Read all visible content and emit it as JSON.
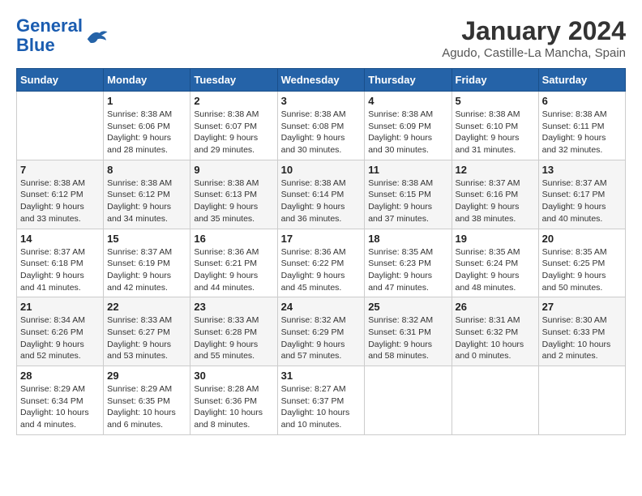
{
  "logo": {
    "line1": "General",
    "line2": "Blue"
  },
  "title": "January 2024",
  "subtitle": "Agudo, Castille-La Mancha, Spain",
  "headers": [
    "Sunday",
    "Monday",
    "Tuesday",
    "Wednesday",
    "Thursday",
    "Friday",
    "Saturday"
  ],
  "weeks": [
    [
      {
        "day": "",
        "info": ""
      },
      {
        "day": "1",
        "info": "Sunrise: 8:38 AM\nSunset: 6:06 PM\nDaylight: 9 hours\nand 28 minutes."
      },
      {
        "day": "2",
        "info": "Sunrise: 8:38 AM\nSunset: 6:07 PM\nDaylight: 9 hours\nand 29 minutes."
      },
      {
        "day": "3",
        "info": "Sunrise: 8:38 AM\nSunset: 6:08 PM\nDaylight: 9 hours\nand 30 minutes."
      },
      {
        "day": "4",
        "info": "Sunrise: 8:38 AM\nSunset: 6:09 PM\nDaylight: 9 hours\nand 30 minutes."
      },
      {
        "day": "5",
        "info": "Sunrise: 8:38 AM\nSunset: 6:10 PM\nDaylight: 9 hours\nand 31 minutes."
      },
      {
        "day": "6",
        "info": "Sunrise: 8:38 AM\nSunset: 6:11 PM\nDaylight: 9 hours\nand 32 minutes."
      }
    ],
    [
      {
        "day": "7",
        "info": "Sunrise: 8:38 AM\nSunset: 6:12 PM\nDaylight: 9 hours\nand 33 minutes."
      },
      {
        "day": "8",
        "info": "Sunrise: 8:38 AM\nSunset: 6:12 PM\nDaylight: 9 hours\nand 34 minutes."
      },
      {
        "day": "9",
        "info": "Sunrise: 8:38 AM\nSunset: 6:13 PM\nDaylight: 9 hours\nand 35 minutes."
      },
      {
        "day": "10",
        "info": "Sunrise: 8:38 AM\nSunset: 6:14 PM\nDaylight: 9 hours\nand 36 minutes."
      },
      {
        "day": "11",
        "info": "Sunrise: 8:38 AM\nSunset: 6:15 PM\nDaylight: 9 hours\nand 37 minutes."
      },
      {
        "day": "12",
        "info": "Sunrise: 8:37 AM\nSunset: 6:16 PM\nDaylight: 9 hours\nand 38 minutes."
      },
      {
        "day": "13",
        "info": "Sunrise: 8:37 AM\nSunset: 6:17 PM\nDaylight: 9 hours\nand 40 minutes."
      }
    ],
    [
      {
        "day": "14",
        "info": "Sunrise: 8:37 AM\nSunset: 6:18 PM\nDaylight: 9 hours\nand 41 minutes."
      },
      {
        "day": "15",
        "info": "Sunrise: 8:37 AM\nSunset: 6:19 PM\nDaylight: 9 hours\nand 42 minutes."
      },
      {
        "day": "16",
        "info": "Sunrise: 8:36 AM\nSunset: 6:21 PM\nDaylight: 9 hours\nand 44 minutes."
      },
      {
        "day": "17",
        "info": "Sunrise: 8:36 AM\nSunset: 6:22 PM\nDaylight: 9 hours\nand 45 minutes."
      },
      {
        "day": "18",
        "info": "Sunrise: 8:35 AM\nSunset: 6:23 PM\nDaylight: 9 hours\nand 47 minutes."
      },
      {
        "day": "19",
        "info": "Sunrise: 8:35 AM\nSunset: 6:24 PM\nDaylight: 9 hours\nand 48 minutes."
      },
      {
        "day": "20",
        "info": "Sunrise: 8:35 AM\nSunset: 6:25 PM\nDaylight: 9 hours\nand 50 minutes."
      }
    ],
    [
      {
        "day": "21",
        "info": "Sunrise: 8:34 AM\nSunset: 6:26 PM\nDaylight: 9 hours\nand 52 minutes."
      },
      {
        "day": "22",
        "info": "Sunrise: 8:33 AM\nSunset: 6:27 PM\nDaylight: 9 hours\nand 53 minutes."
      },
      {
        "day": "23",
        "info": "Sunrise: 8:33 AM\nSunset: 6:28 PM\nDaylight: 9 hours\nand 55 minutes."
      },
      {
        "day": "24",
        "info": "Sunrise: 8:32 AM\nSunset: 6:29 PM\nDaylight: 9 hours\nand 57 minutes."
      },
      {
        "day": "25",
        "info": "Sunrise: 8:32 AM\nSunset: 6:31 PM\nDaylight: 9 hours\nand 58 minutes."
      },
      {
        "day": "26",
        "info": "Sunrise: 8:31 AM\nSunset: 6:32 PM\nDaylight: 10 hours\nand 0 minutes."
      },
      {
        "day": "27",
        "info": "Sunrise: 8:30 AM\nSunset: 6:33 PM\nDaylight: 10 hours\nand 2 minutes."
      }
    ],
    [
      {
        "day": "28",
        "info": "Sunrise: 8:29 AM\nSunset: 6:34 PM\nDaylight: 10 hours\nand 4 minutes."
      },
      {
        "day": "29",
        "info": "Sunrise: 8:29 AM\nSunset: 6:35 PM\nDaylight: 10 hours\nand 6 minutes."
      },
      {
        "day": "30",
        "info": "Sunrise: 8:28 AM\nSunset: 6:36 PM\nDaylight: 10 hours\nand 8 minutes."
      },
      {
        "day": "31",
        "info": "Sunrise: 8:27 AM\nSunset: 6:37 PM\nDaylight: 10 hours\nand 10 minutes."
      },
      {
        "day": "",
        "info": ""
      },
      {
        "day": "",
        "info": ""
      },
      {
        "day": "",
        "info": ""
      }
    ]
  ]
}
